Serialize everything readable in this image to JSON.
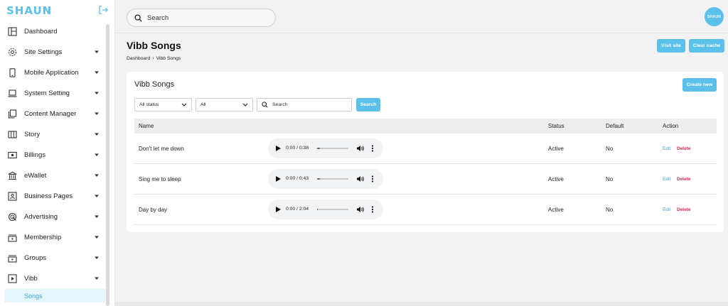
{
  "brand": {
    "logo_text": "SHAUN",
    "accent": "#5bc0ea",
    "delete_color": "#e0224e"
  },
  "sidebar": {
    "items": [
      {
        "label": "Dashboard",
        "icon": "dashboard-icon",
        "has_caret": false
      },
      {
        "label": "Site Settings",
        "icon": "gear-icon",
        "has_caret": true
      },
      {
        "label": "Mobile Application",
        "icon": "phone-icon",
        "has_caret": true
      },
      {
        "label": "System Setting",
        "icon": "laptop-icon",
        "has_caret": true
      },
      {
        "label": "Content Manager",
        "icon": "copy-icon",
        "has_caret": true
      },
      {
        "label": "Story",
        "icon": "columns-icon",
        "has_caret": true
      },
      {
        "label": "Billings",
        "icon": "money-icon",
        "has_caret": true
      },
      {
        "label": "eWallet",
        "icon": "bank-icon",
        "has_caret": true
      },
      {
        "label": "Business Pages",
        "icon": "business-card-icon",
        "has_caret": true
      },
      {
        "label": "Advertising",
        "icon": "target-icon",
        "has_caret": true
      },
      {
        "label": "Membership",
        "icon": "membership-icon",
        "has_caret": true
      },
      {
        "label": "Groups",
        "icon": "groups-icon",
        "has_caret": true
      },
      {
        "label": "Vibb",
        "icon": "video-play-icon",
        "has_caret": true
      }
    ],
    "subitem": "Songs"
  },
  "topbar": {
    "search_placeholder": "Search",
    "avatar_text": "SHAUN"
  },
  "page": {
    "title": "Vibb Songs",
    "breadcrumb": [
      "Dashboard",
      "Vibb Songs"
    ],
    "visit_site": "Visit site",
    "clear_cache": "Clear cache"
  },
  "card": {
    "title": "Vibb Songs",
    "create_new": "Create new",
    "filter_status": "All status",
    "filter_all": "All",
    "search_placeholder": "Search",
    "search_button": "Search",
    "columns": {
      "name": "Name",
      "status": "Status",
      "default": "Default",
      "action": "Action"
    },
    "rows": [
      {
        "name": "Don't let me down",
        "time": "0:00 / 0:38",
        "progress": 0.08,
        "status": "Active",
        "default": "No",
        "edit": "Edit",
        "delete": "Delete"
      },
      {
        "name": "Sing me to sleep",
        "time": "0:00 / 0:43",
        "progress": 0.08,
        "status": "Active",
        "default": "No",
        "edit": "Edit",
        "delete": "Delete"
      },
      {
        "name": "Day by day",
        "time": "0:00 / 2:04",
        "progress": 0.02,
        "status": "Active",
        "default": "No",
        "edit": "Edit",
        "delete": "Delete"
      }
    ]
  }
}
